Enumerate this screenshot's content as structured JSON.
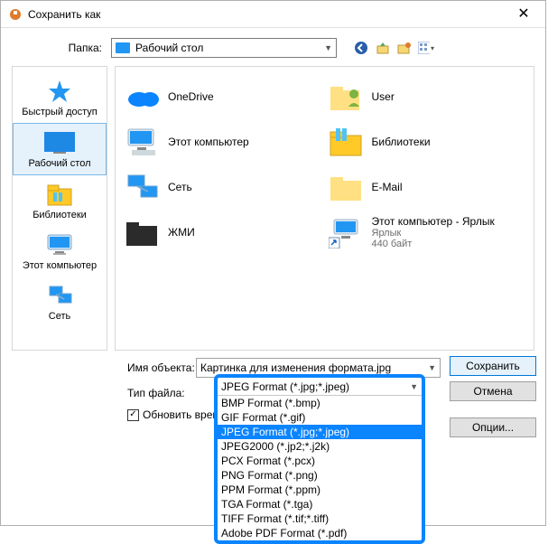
{
  "title": "Сохранить как",
  "folder": {
    "label": "Папка:",
    "value": "Рабочий стол"
  },
  "places": {
    "quick": "Быстрый доступ",
    "desktop": "Рабочий стол",
    "libs": "Библиотеки",
    "thispc": "Этот компьютер",
    "network": "Сеть"
  },
  "items": {
    "onedrive": "OneDrive",
    "user": "User",
    "thispc": "Этот компьютер",
    "libs": "Библиотеки",
    "network": "Сеть",
    "email": "E-Mail",
    "zhmi": "ЖМИ",
    "shortcut": {
      "name": "Этот компьютер - Ярлык",
      "type": "Ярлык",
      "size": "440 байт"
    }
  },
  "filename_label": "Имя объекта:",
  "filename_value": "Картинка для изменения формата.jpg",
  "filetype_label": "Тип файла:",
  "dropdown": {
    "selected": "JPEG Format (*.jpg;*.jpeg)",
    "opts": [
      "BMP Format (*.bmp)",
      "GIF Format (*.gif)",
      "JPEG Format (*.jpg;*.jpeg)",
      "JPEG2000 (*.jp2;*.j2k)",
      "PCX Format (*.pcx)",
      "PNG Format (*.png)",
      "PPM Format (*.ppm)",
      "TGA Format (*.tga)",
      "TIFF Format (*.tif;*.tiff)",
      "Adobe PDF Format (*.pdf)"
    ]
  },
  "buttons": {
    "save": "Сохранить",
    "cancel": "Отмена",
    "options": "Опции..."
  },
  "checkbox": "Обновить время ф"
}
